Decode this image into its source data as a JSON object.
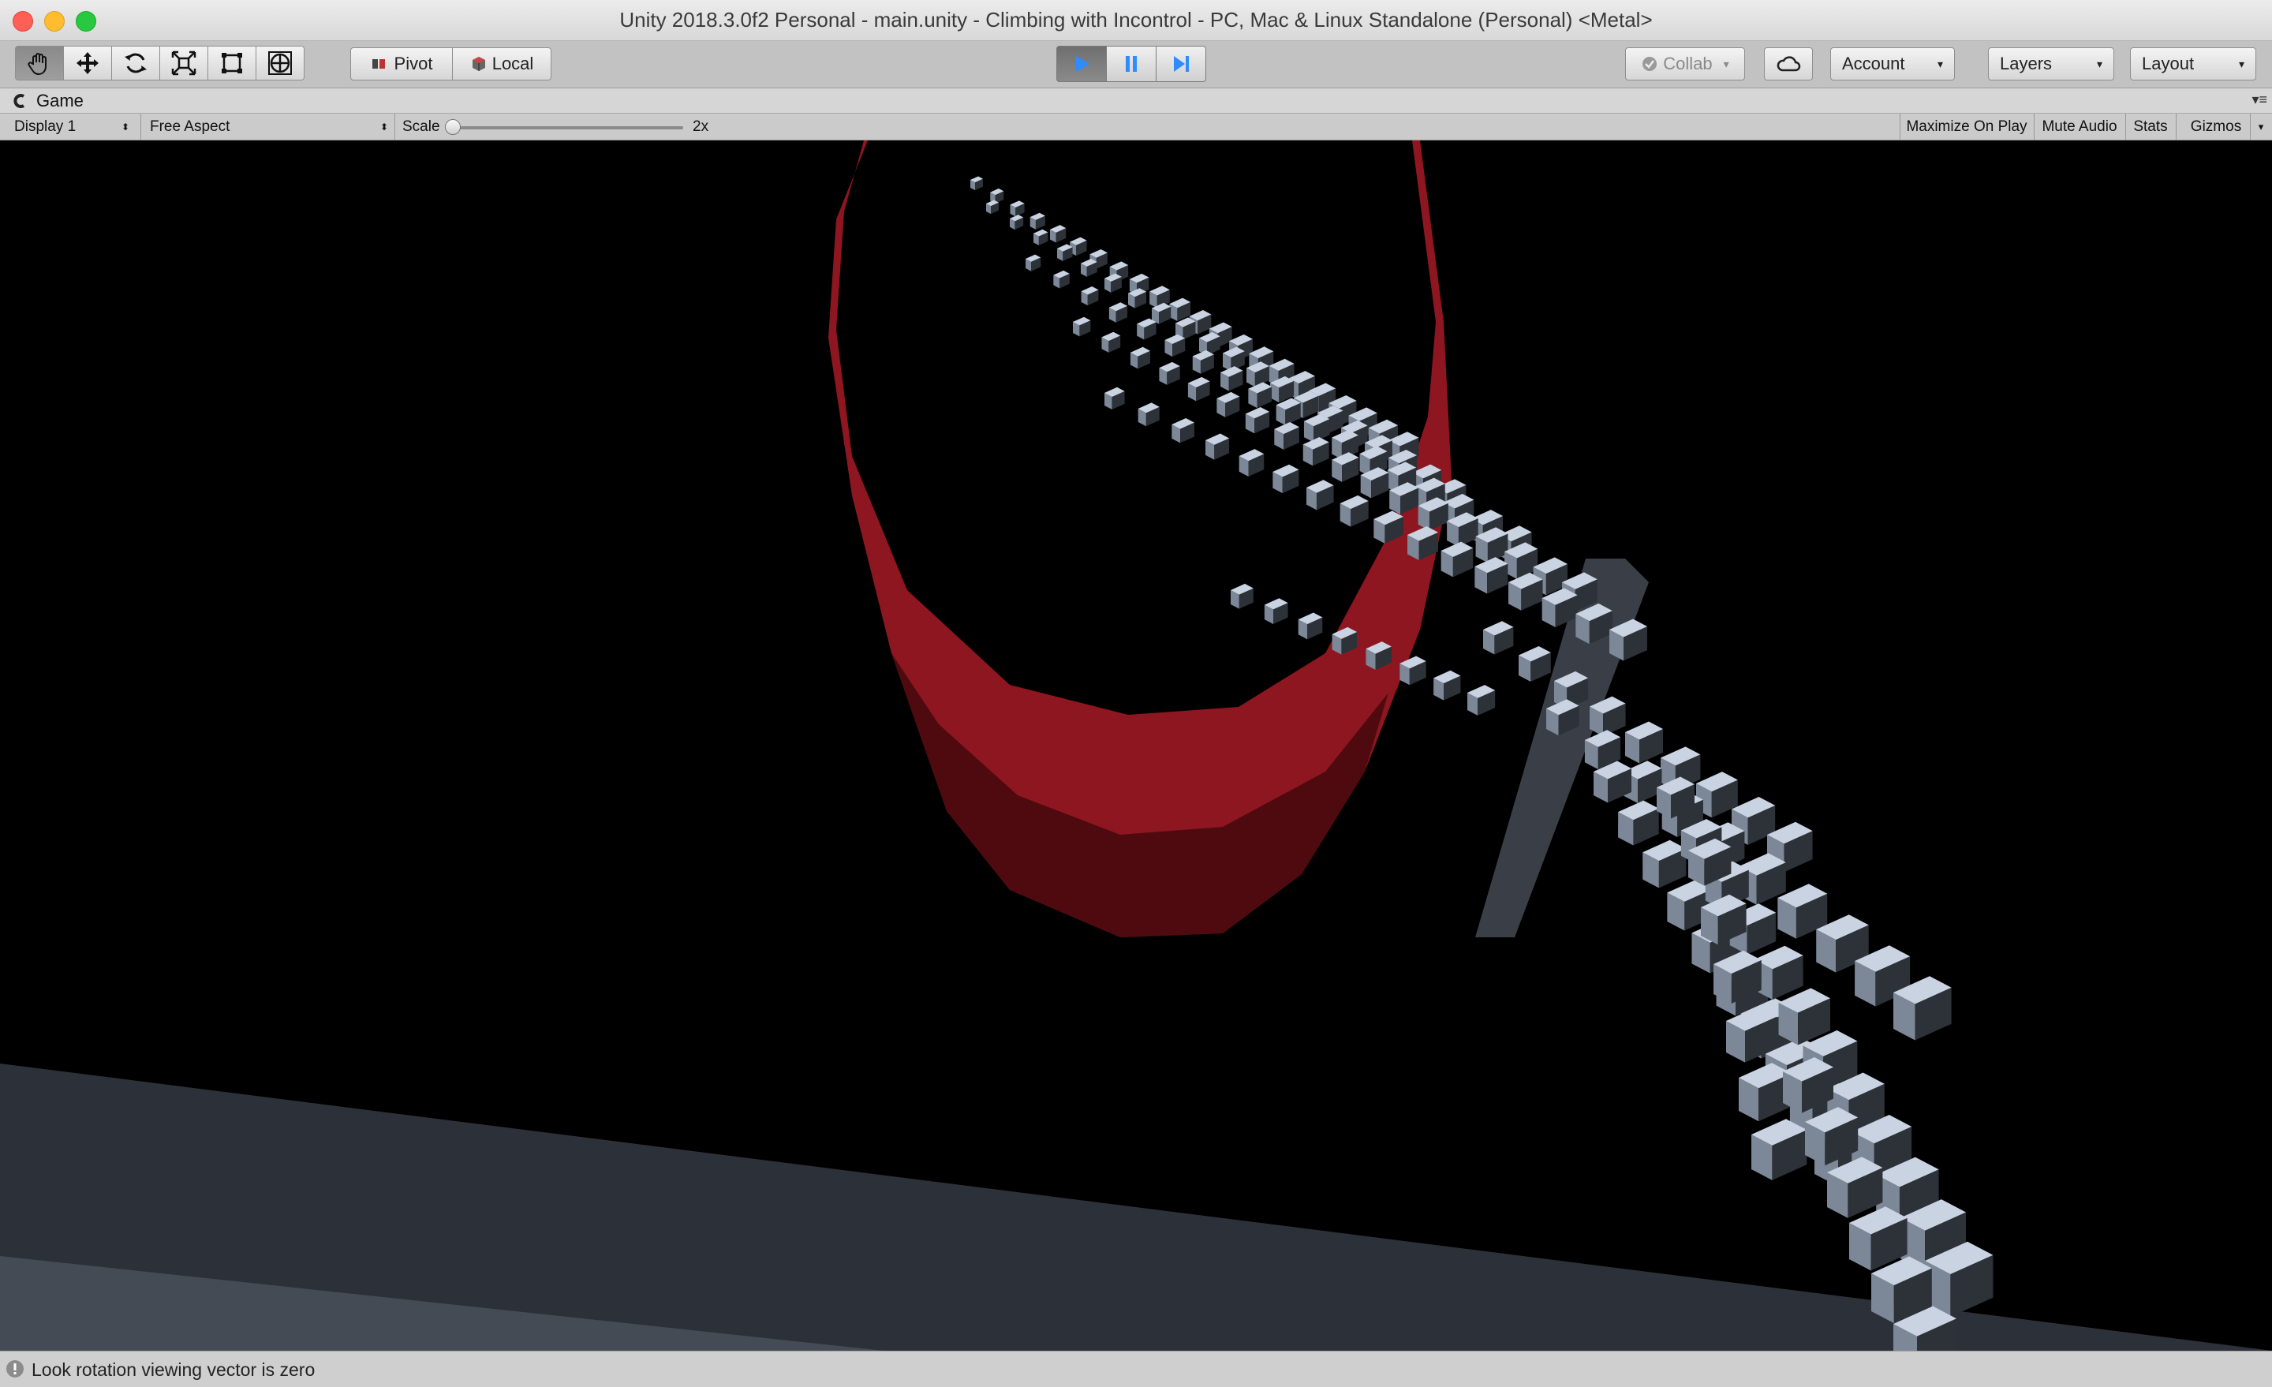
{
  "window": {
    "title": "Unity 2018.3.0f2 Personal - main.unity - Climbing with Incontrol - PC, Mac & Linux Standalone (Personal) <Metal>"
  },
  "toolbar": {
    "tools": [
      "hand-tool-icon",
      "move-tool-icon",
      "rotate-tool-icon",
      "scale-tool-icon",
      "rect-tool-icon",
      "transform-tool-icon"
    ],
    "pivot_label": "Pivot",
    "local_label": "Local",
    "collab_label": "Collab",
    "account_label": "Account",
    "layers_label": "Layers",
    "layout_label": "Layout",
    "play_accent": "#2f8cff"
  },
  "game_tab": {
    "title": "Game"
  },
  "game_bar": {
    "display": "Display 1",
    "aspect": "Free Aspect",
    "scale_label": "Scale",
    "scale_value": "2x",
    "scale_level": 0.0,
    "maximize_on_play": "Maximize On Play",
    "mute_audio": "Mute Audio",
    "stats": "Stats",
    "gizmos": "Gizmos"
  },
  "scene": {
    "ring_color": "#8e1620",
    "ring_dark": "#4f0a10",
    "floor_color": "#2c3038",
    "floor_light": "#454b55",
    "cube_light": "#c9d3e2",
    "cube_mid": "#7c8797",
    "cube_dark": "#2d3138"
  },
  "status": {
    "message": "Look rotation viewing vector is zero"
  }
}
